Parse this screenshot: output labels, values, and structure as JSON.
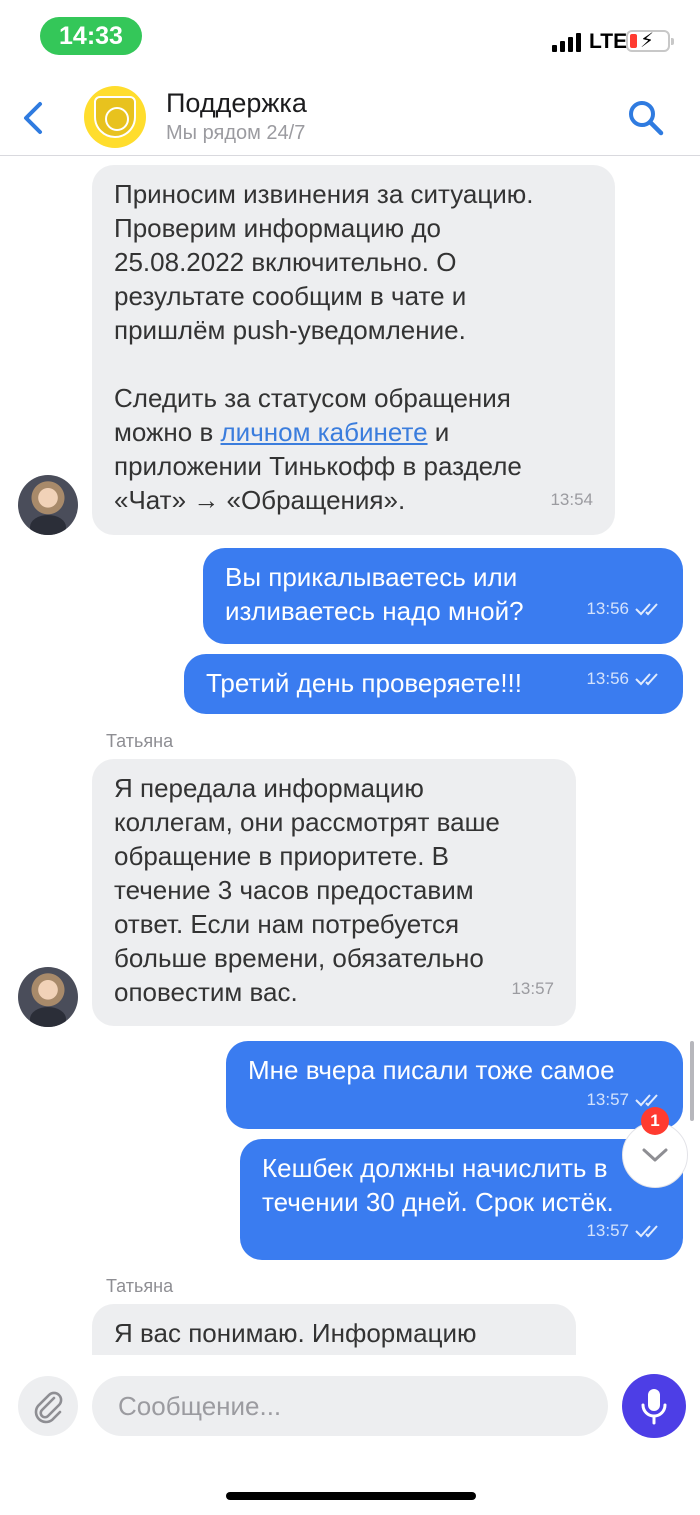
{
  "status_bar": {
    "time": "14:33",
    "network": "LTE"
  },
  "header": {
    "title": "Поддержка",
    "subtitle": "Мы рядом 24/7"
  },
  "messages": {
    "m1": {
      "line1": "Приносим извинения за ситуацию.",
      "line2": "Проверим информацию  до",
      "line3": "25.08.2022 включительно. О",
      "line4": "результате сообщим в чате и",
      "line5": "пришлём push-уведомление.",
      "line6": "Следить за статусом обращения",
      "line7_pre": "можно в ",
      "line7_link": "личном кабинете",
      "line7_post": " и",
      "line8": "приложении Тинькофф в разделе",
      "line9": "«Чат» → «Обращения».",
      "time": "13:54"
    },
    "m2": {
      "line1": "Вы прикалываетесь или",
      "line2": "изливаетесь надо мной?",
      "time": "13:56"
    },
    "m3": {
      "text": "Третий день проверяете!!!",
      "time": "13:56"
    },
    "sender1": "Татьяна",
    "m4": {
      "line1": "Я передала информацию",
      "line2": "коллегам, они рассмотрят ваше",
      "line3": "обращение в приоритете. В",
      "line4": "течение 3 часов предоставим",
      "line5": "ответ. Если нам потребуется",
      "line6": "больше времени, обязательно",
      "line7": "оповестим вас.",
      "time": "13:57"
    },
    "m5": {
      "text": "Мне вчера писали тоже самое",
      "time": "13:57"
    },
    "m6": {
      "line1": "Кешбек должны начислить в",
      "line2": "течении 30 дней. Срок истёк.",
      "time": "13:57"
    },
    "sender2": "Татьяна",
    "m7": {
      "line1": "Я вас понимаю. Информацию"
    }
  },
  "unread_badge": "1",
  "composer": {
    "placeholder": "Сообщение..."
  },
  "icons": {
    "back": "chevron-left-icon",
    "search": "search-icon",
    "attach": "paperclip-icon",
    "mic": "microphone-icon",
    "scroll_down": "chevron-down-icon",
    "read": "double-check-icon"
  },
  "colors": {
    "accent": "#3a7cf0",
    "incoming_bubble": "#edeef0",
    "mic": "#4d3ee6",
    "brand": "#ffdd2d",
    "time_pill": "#34c759"
  }
}
